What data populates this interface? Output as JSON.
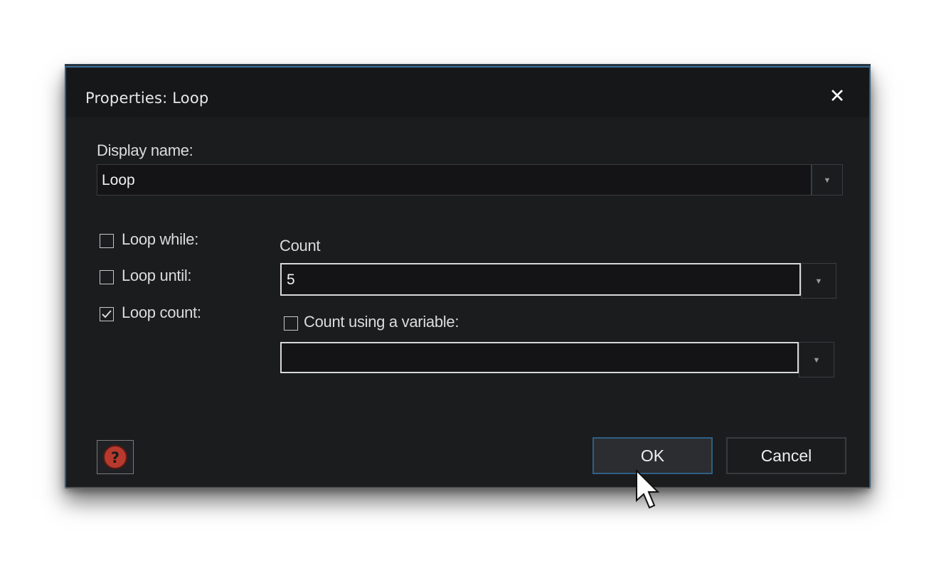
{
  "dialog": {
    "title": "Properties: Loop",
    "close_icon": "close-icon"
  },
  "display_name": {
    "label": "Display name:",
    "value": "Loop"
  },
  "loop_options": [
    {
      "label": "Loop while:",
      "checked": false
    },
    {
      "label": "Loop until:",
      "checked": false
    },
    {
      "label": "Loop count:",
      "checked": true
    }
  ],
  "count": {
    "label": "Count",
    "value": "5",
    "use_variable_label": "Count using a variable:",
    "use_variable_checked": false,
    "variable_value": ""
  },
  "buttons": {
    "ok_label": "OK",
    "cancel_label": "Cancel",
    "help_icon": "help-icon"
  },
  "colors": {
    "background": "#1b1c1e",
    "accent_border": "#2f5f86",
    "help_icon": "#b83a2e"
  }
}
